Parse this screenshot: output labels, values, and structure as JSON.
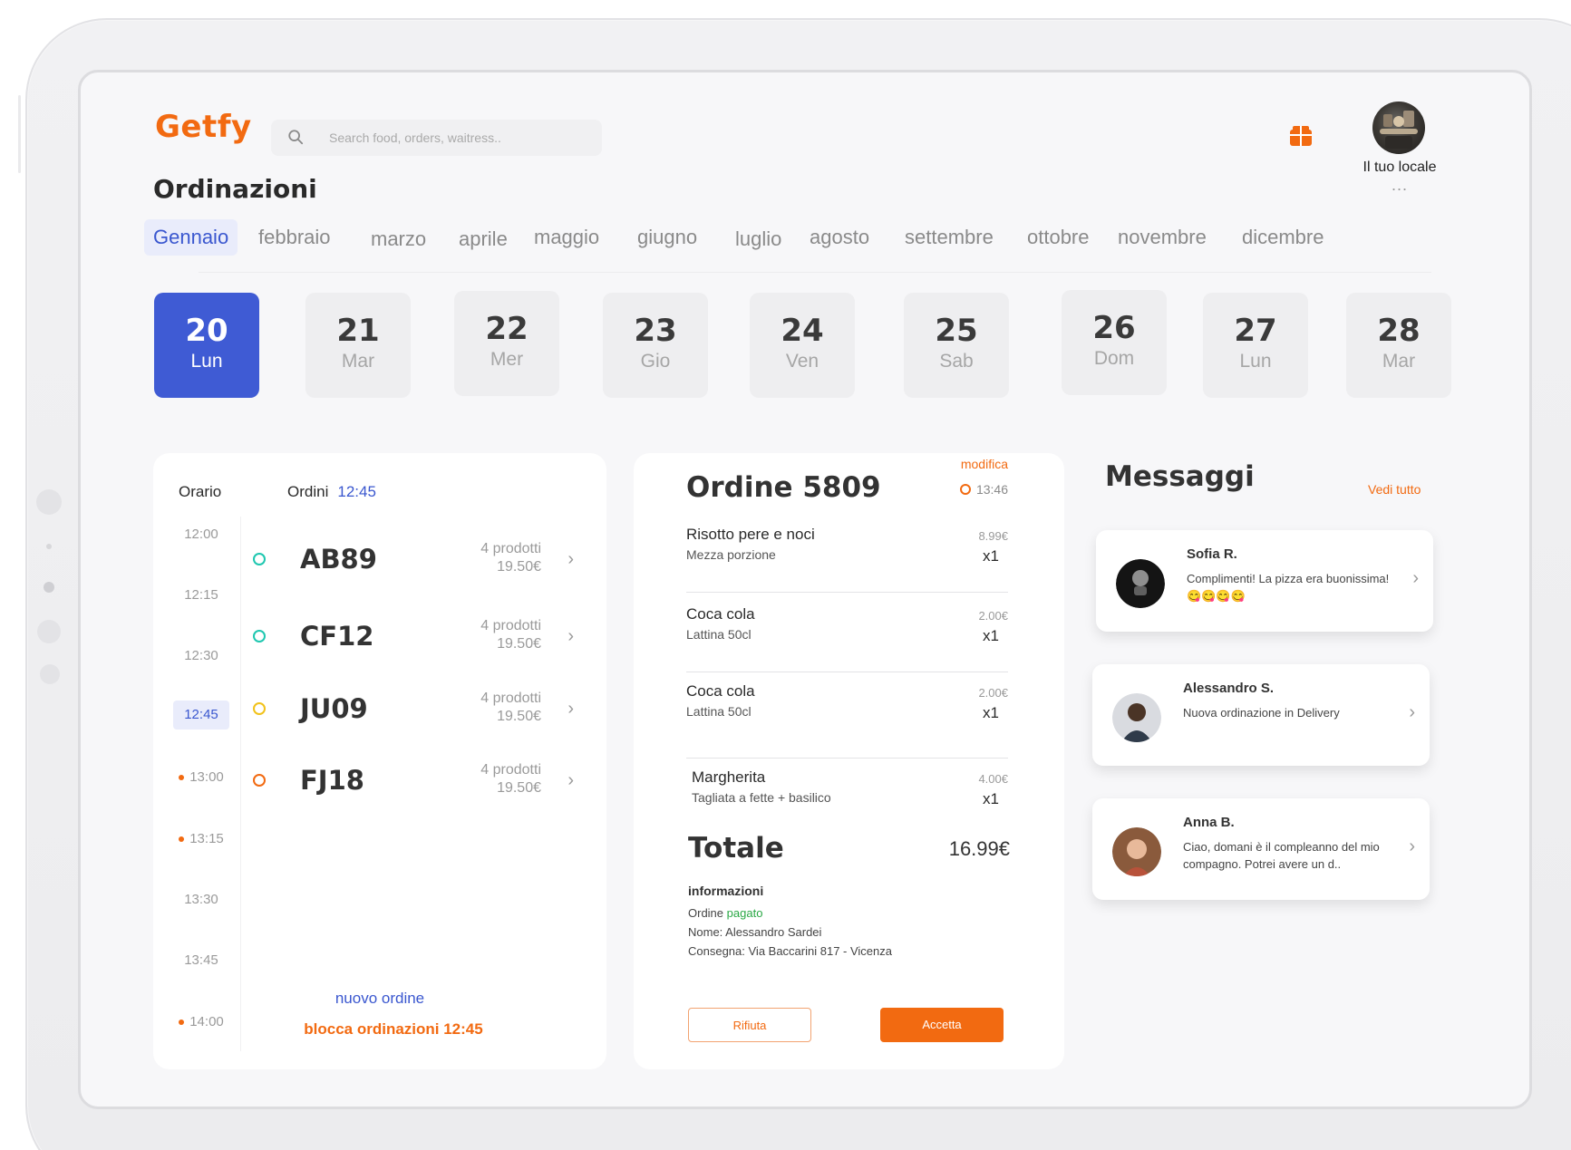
{
  "app": {
    "logo": "Getfy"
  },
  "search": {
    "placeholder": "Search food, orders, waitress.."
  },
  "profile": {
    "name": "Il tuo locale",
    "dots": "..."
  },
  "page_title": "Ordinazioni",
  "months": [
    "Gennaio",
    "febbraio",
    "marzo",
    "aprile",
    "maggio",
    "giugno",
    "luglio",
    "agosto",
    "settembre",
    "ottobre",
    "novembre",
    "dicembre"
  ],
  "days": [
    {
      "num": "20",
      "dow": "Lun"
    },
    {
      "num": "21",
      "dow": "Mar"
    },
    {
      "num": "22",
      "dow": "Mer"
    },
    {
      "num": "23",
      "dow": "Gio"
    },
    {
      "num": "24",
      "dow": "Ven"
    },
    {
      "num": "25",
      "dow": "Sab"
    },
    {
      "num": "26",
      "dow": "Dom"
    },
    {
      "num": "27",
      "dow": "Lun"
    },
    {
      "num": "28",
      "dow": "Mar"
    }
  ],
  "schedule": {
    "col_time": "Orario",
    "col_orders": "Ordini",
    "selected_time": "12:45",
    "times": [
      "12:00",
      "12:15",
      "12:30",
      "12:45",
      "13:00",
      "13:15",
      "13:30",
      "13:45",
      "14:00"
    ],
    "orders": [
      {
        "code": "AB89",
        "products": "4 prodotti",
        "price": "19.50€",
        "color": "#1fc7b0"
      },
      {
        "code": "CF12",
        "products": "4 prodotti",
        "price": "19.50€",
        "color": "#1fc7b0"
      },
      {
        "code": "JU09",
        "products": "4 prodotti",
        "price": "19.50€",
        "color": "#f1c21b"
      },
      {
        "code": "FJ18",
        "products": "4 prodotti",
        "price": "19.50€",
        "color": "#f26a11"
      }
    ],
    "new_order": "nuovo ordine",
    "block_orders": "blocca ordinazioni 12:45"
  },
  "order": {
    "title": "Ordine 5809",
    "edit": "modifica",
    "time": "13:46",
    "items": [
      {
        "name": "Risotto pere e noci",
        "desc": "Mezza porzione",
        "price": "8.99€",
        "qty": "x1"
      },
      {
        "name": "Coca cola",
        "desc": "Lattina 50cl",
        "price": "2.00€",
        "qty": "x1"
      },
      {
        "name": "Coca cola",
        "desc": "Lattina 50cl",
        "price": "2.00€",
        "qty": "x1"
      },
      {
        "name": "Margherita",
        "desc": "Tagliata a fette +  basilico",
        "price": "4.00€",
        "qty": "x1"
      }
    ],
    "total_label": "Totale",
    "total": "16.99€",
    "info_title": "informazioni",
    "status_prefix": "Ordine",
    "status": "pagato",
    "customer": "Nome: Alessandro Sardei",
    "delivery": "Consegna: Via Baccarini 817 - Vicenza",
    "reject": "Rifiuta",
    "accept": "Accetta"
  },
  "messages": {
    "title": "Messaggi",
    "see_all": "Vedi tutto",
    "items": [
      {
        "name": "Sofia R.",
        "text": "Complimenti! La pizza era buonissima! 😋😋😋😋"
      },
      {
        "name": "Alessandro S.",
        "text": "Nuova ordinazione in Delivery"
      },
      {
        "name": "Anna B.",
        "text": "Ciao, domani è il compleanno del mio compagno. Potrei avere un d.."
      }
    ]
  },
  "colors": {
    "brand": "#f26a11",
    "accent": "#3f5bd4",
    "paid": "#2aa845"
  }
}
